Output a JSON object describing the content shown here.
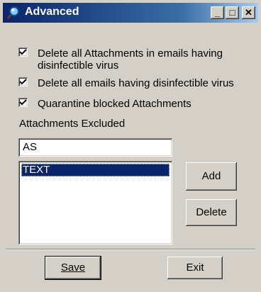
{
  "window": {
    "title": "Advanced"
  },
  "title_buttons": {
    "minimize": "_",
    "maximize": "□",
    "close": "✕"
  },
  "options": [
    {
      "label": "Delete all Attachments in emails having disinfectible virus",
      "checked": true
    },
    {
      "label": "Delete all emails having disinfectible virus",
      "checked": true
    },
    {
      "label": "Quarantine blocked Attachments",
      "checked": true
    }
  ],
  "attachments": {
    "label": "Attachments Excluded",
    "input_value": "AS",
    "list_items": [
      "TEXT"
    ],
    "selected_index": 0
  },
  "buttons": {
    "add": "Add",
    "delete": "Delete",
    "save": "Save",
    "exit": "Exit"
  }
}
